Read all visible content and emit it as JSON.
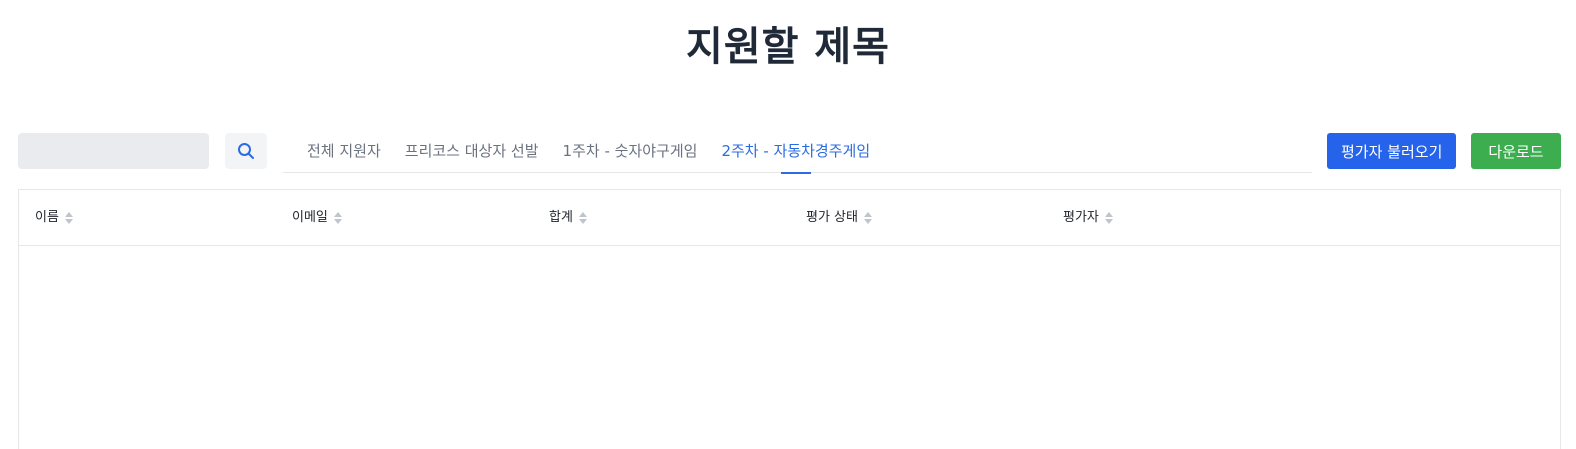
{
  "page": {
    "title": "지원할 제목"
  },
  "search": {
    "placeholder": "",
    "value": ""
  },
  "tabs": [
    {
      "label": "전체 지원자",
      "active": false
    },
    {
      "label": "프리코스 대상자 선발",
      "active": false
    },
    {
      "label": "1주차 - 숫자야구게임",
      "active": false
    },
    {
      "label": "2주차 - 자동차경주게임",
      "active": true
    }
  ],
  "buttons": {
    "load_evaluator": "평가자 불러오기",
    "download": "다운로드"
  },
  "table": {
    "columns": [
      "이름",
      "이메일",
      "합계",
      "평가 상태",
      "평가자"
    ],
    "rows": []
  },
  "colors": {
    "accent": "#2b6be4",
    "primary_button": "#2563eb",
    "download_button": "#3cae50"
  }
}
